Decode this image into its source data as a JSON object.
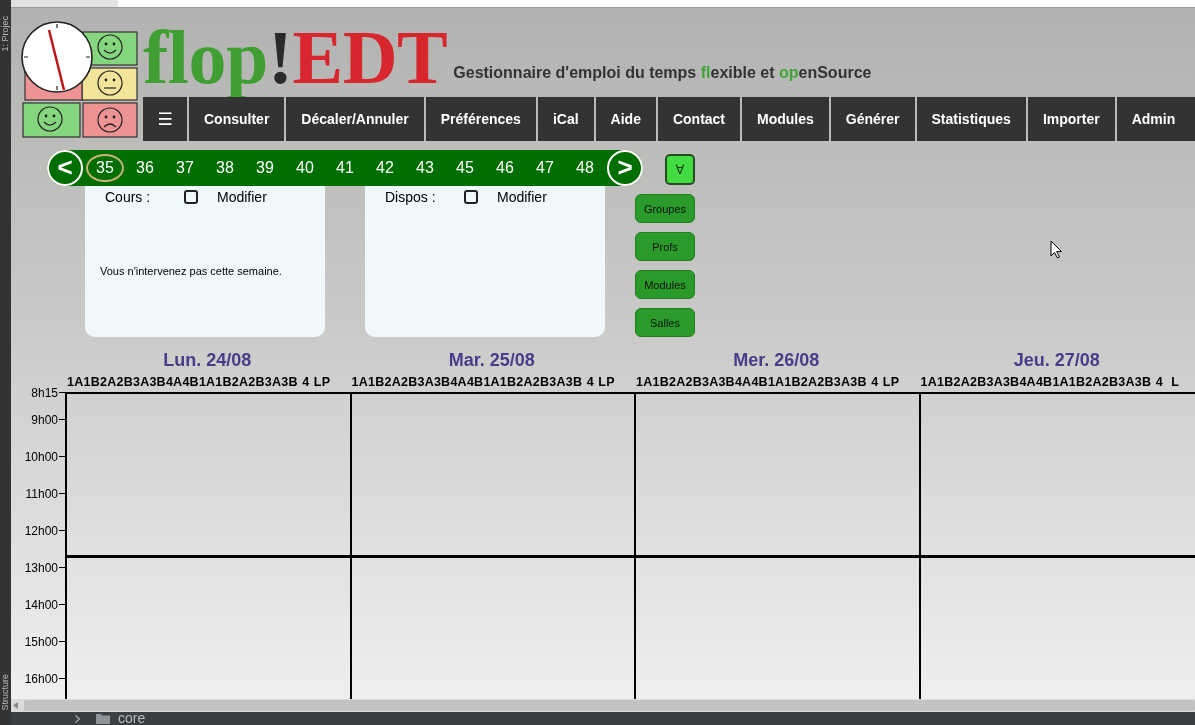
{
  "ide": {
    "side_tabs": [
      "1: Projec",
      "Structure"
    ],
    "path": "core"
  },
  "logo": {
    "parts": [
      {
        "text": "flop",
        "color": "#3f9f33"
      },
      {
        "text": "!",
        "color": "#2a2a2a"
      },
      {
        "text": "EDT",
        "color": "#d8262e"
      }
    ]
  },
  "tagline": [
    {
      "text": "Gestionnaire d'emploi du temps ",
      "accent": false
    },
    {
      "text": "fl",
      "accent": true
    },
    {
      "text": "exible et ",
      "accent": false
    },
    {
      "text": "op",
      "accent": true
    },
    {
      "text": "enSource",
      "accent": false
    }
  ],
  "nav": [
    {
      "label": "☰"
    },
    {
      "label": "Consulter"
    },
    {
      "label": "Décaler/Annuler"
    },
    {
      "label": "Préférences"
    },
    {
      "label": "iCal"
    },
    {
      "label": "Aide"
    },
    {
      "label": "Contact"
    },
    {
      "label": "Modules"
    },
    {
      "label": "Générer"
    },
    {
      "label": "Statistiques"
    },
    {
      "label": "Importer"
    },
    {
      "label": "Admin"
    }
  ],
  "weeks": {
    "prev": "<",
    "next": ">",
    "items": [
      {
        "label": "35",
        "selected": true
      },
      {
        "label": "36",
        "selected": false
      },
      {
        "label": "37",
        "selected": false
      },
      {
        "label": "38",
        "selected": false
      },
      {
        "label": "39",
        "selected": false
      },
      {
        "label": "40",
        "selected": false
      },
      {
        "label": "41",
        "selected": false
      },
      {
        "label": "42",
        "selected": false
      },
      {
        "label": "43",
        "selected": false
      },
      {
        "label": "45",
        "selected": false
      },
      {
        "label": "46",
        "selected": false
      },
      {
        "label": "47",
        "selected": false
      },
      {
        "label": "48",
        "selected": false
      }
    ]
  },
  "filter_all": "∀",
  "panels": [
    {
      "title": "Cours :",
      "checkbox": {
        "label": "Modifier",
        "checked": false
      },
      "message": "Vous n'intervenez pas cette semaine."
    },
    {
      "title": "Dispos :",
      "checkbox": {
        "label": "Modifier",
        "checked": false
      }
    }
  ],
  "views": [
    "Groupes",
    "Profs",
    "Modules",
    "Salles"
  ],
  "schedule": {
    "days": [
      {
        "label": "Lun. 24/08",
        "groups": [
          "1A",
          "1B",
          "2A",
          "2B",
          "3A",
          "3B",
          "4A",
          "4B",
          "1A",
          "1B",
          "2A",
          "2B",
          "3A",
          "3B",
          "4",
          "LP"
        ]
      },
      {
        "label": "Mar. 25/08",
        "groups": [
          "1A",
          "1B",
          "2A",
          "2B",
          "3A",
          "3B",
          "4A",
          "4B",
          "1A",
          "1B",
          "2A",
          "2B",
          "3A",
          "3B",
          "4",
          "LP"
        ]
      },
      {
        "label": "Mer. 26/08",
        "groups": [
          "1A",
          "1B",
          "2A",
          "2B",
          "3A",
          "3B",
          "4A",
          "4B",
          "1A",
          "1B",
          "2A",
          "2B",
          "3A",
          "3B",
          "4",
          "LP"
        ]
      },
      {
        "label": "Jeu. 27/08",
        "groups": [
          "1A",
          "1B",
          "2A",
          "2B",
          "3A",
          "3B",
          "4A",
          "4B",
          "1A",
          "1B",
          "2A",
          "2B",
          "3A",
          "3B",
          "4",
          "L"
        ]
      }
    ],
    "hours": [
      "8h15",
      "9h00",
      "10h00",
      "11h00",
      "12h00",
      "13h00",
      "14h00",
      "15h00",
      "16h00"
    ]
  }
}
